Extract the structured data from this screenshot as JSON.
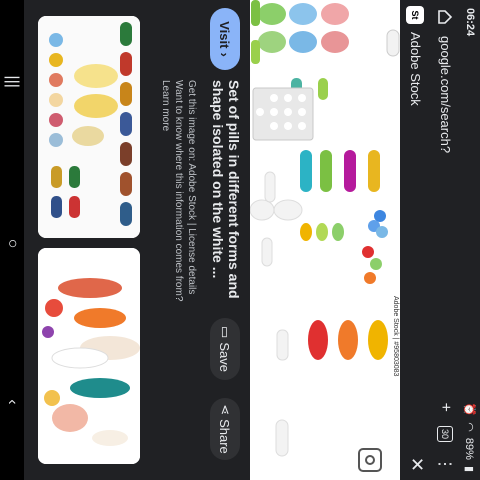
{
  "status_bar": {
    "time": "06:24",
    "battery": "89%"
  },
  "browser": {
    "url": "google.com/search?",
    "tab_count": "30"
  },
  "source": {
    "name": "Adobe Stock",
    "badge": "St"
  },
  "preview": {
    "credit": "Adobe Stock | #95803083"
  },
  "result": {
    "visit_label": "Visit",
    "title": "Set of pills in different forms and shape isolated on the white ...",
    "save_label": "Save",
    "share_label": "Share",
    "notice": "Want to know where this information comes from? Learn more",
    "license": "Get this image on: Adobe Stock | License details",
    "learn_more": "Learn more"
  },
  "colors": {
    "background": "#202124",
    "text": "#e8eaed",
    "accent": "#8ab4f8"
  }
}
